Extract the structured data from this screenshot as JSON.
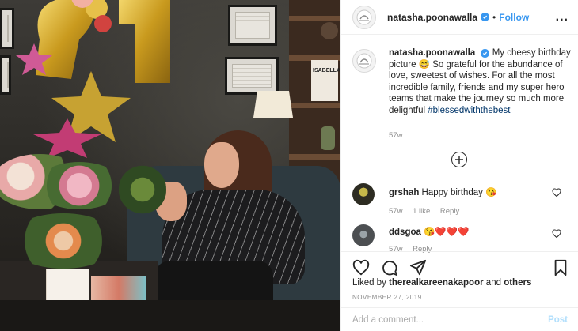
{
  "photo": {
    "alt_scene": "",
    "frame_text": "ISABELLA"
  },
  "header": {
    "username": "natasha.poonawalla",
    "separator": "•",
    "follow_label": "Follow",
    "more_label": "..."
  },
  "caption": {
    "username": "natasha.poonawalla",
    "text_before_tag": "My cheesy birthday picture 😅 So grateful for the abundance of love, sweetest of wishes. For all the most incredible family, friends and my super hero teams that make the journey so much more delightful",
    "hashtag": "#blessedwiththebest",
    "time": "57w"
  },
  "comments": [
    {
      "username": "grshah",
      "text": "Happy birthday 😘",
      "time": "57w",
      "likes": "1 like",
      "reply": "Reply"
    },
    {
      "username": "ddsgoa",
      "text": "😘❤️❤️❤️",
      "time": "57w",
      "reply": "Reply"
    }
  ],
  "likes": {
    "prefix": "Liked by",
    "user": "therealkareenakapoor",
    "and": "and",
    "others": "others"
  },
  "date": "NOVEMBER 27, 2019",
  "add_comment": {
    "placeholder": "Add a comment...",
    "post_label": "Post"
  },
  "colors": {
    "link_blue": "#3897f0",
    "hashtag": "#003569",
    "muted": "#8e8e8e",
    "post_disabled": "#b2dffc"
  },
  "icons": [
    "verified-icon",
    "more-icon",
    "load-more-icon",
    "heart-icon",
    "comment-icon",
    "share-icon",
    "save-icon"
  ]
}
